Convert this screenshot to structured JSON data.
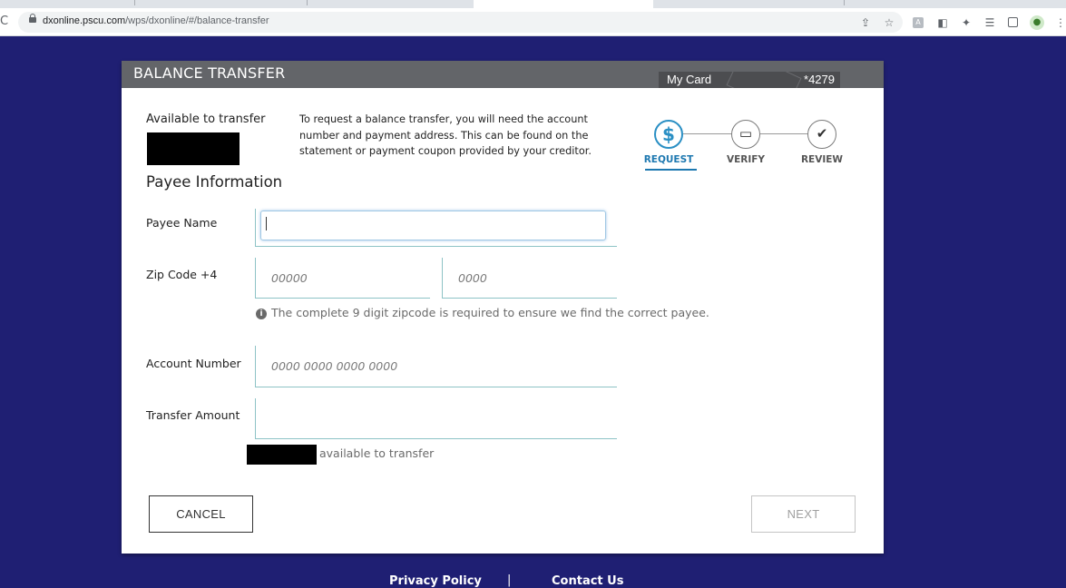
{
  "browser": {
    "url_host": "dxonline.pscu.com",
    "url_path": "/wps/dxonline/#/balance-transfer",
    "icons": [
      "reload-icon",
      "lock-icon",
      "share-icon",
      "star-icon",
      "extension-icon",
      "puzzle-icon",
      "reading-list-icon",
      "side-panel-icon",
      "profile-avatar",
      "more-icon"
    ]
  },
  "modal": {
    "title": "BALANCE TRANSFER",
    "card": {
      "name": "My Card",
      "number": "*4279"
    },
    "available_label": "Available to transfer",
    "info_text": "To request a balance transfer, you will need the account number and payment address. This can be found on the statement or payment coupon provided by your creditor.",
    "steps": [
      {
        "label": "REQUEST",
        "icon": "dollar-icon",
        "active": true
      },
      {
        "label": "VERIFY",
        "icon": "check-card-icon",
        "active": false
      },
      {
        "label": "REVIEW",
        "icon": "checkmark-icon",
        "active": false
      }
    ],
    "section_title": "Payee Information",
    "fields": {
      "payee_name": {
        "label": "Payee Name",
        "value": "",
        "placeholder": ""
      },
      "zip": {
        "label": "Zip Code +4",
        "placeholder_main": "00000",
        "placeholder_ext": "0000"
      },
      "zip_hint": "The complete 9 digit zipcode is required to ensure we find the correct payee.",
      "account_number": {
        "label": "Account Number",
        "placeholder": "0000 0000 0000 0000"
      },
      "transfer_amount": {
        "label": "Transfer Amount",
        "value": ""
      }
    },
    "available_after": "available to transfer",
    "buttons": {
      "cancel": "CANCEL",
      "next": "NEXT"
    }
  },
  "footer": {
    "privacy": "Privacy Policy",
    "separator": "|",
    "contact": "Contact Us"
  },
  "colors": {
    "background": "#1f1f73",
    "accent": "#1d78b0",
    "header": "#636569"
  }
}
